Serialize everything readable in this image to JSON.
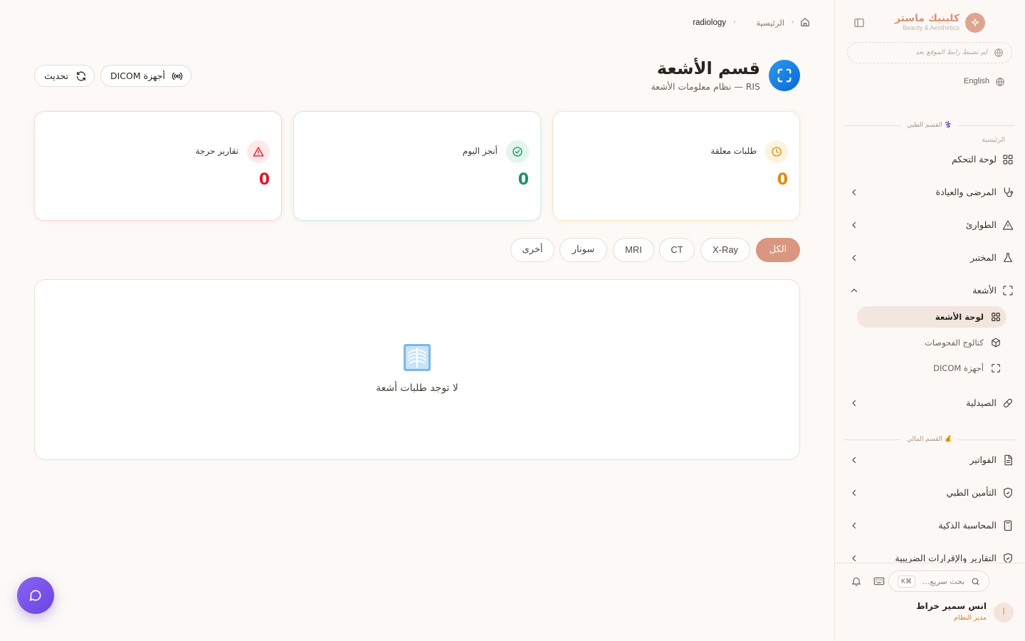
{
  "sidebar": {
    "brand": {
      "name": "كلينيك ماستر",
      "tagline": "Beauty & Aesthetics"
    },
    "site_url_placeholder": "لم تضبط رابط الموقع بعد",
    "language": "English",
    "medical_section": {
      "label": "⚕️ القسم الطبي",
      "caption": "الرئيسية"
    },
    "items": [
      {
        "label": "لوحة التحكم",
        "icon": "dashboard-icon"
      },
      {
        "label": "المرضى والعيادة",
        "icon": "stethoscope-icon"
      },
      {
        "label": "الطوارئ",
        "icon": "warning-icon"
      },
      {
        "label": "المختبر",
        "icon": "flask-icon"
      },
      {
        "label": "الأشعة",
        "icon": "scan-icon",
        "expanded": true
      },
      {
        "label": "الصيدلية",
        "icon": "pill-icon"
      }
    ],
    "radiology_sub": [
      {
        "label": "لوحة الأشعة",
        "icon": "dashboard-icon",
        "active": true
      },
      {
        "label": "كتالوج الفحوصات",
        "icon": "box-icon"
      },
      {
        "label": "أجهزة DICOM",
        "icon": "scan-icon"
      }
    ],
    "financial_section": {
      "label": "💰 القسم المالي"
    },
    "financial_items": [
      {
        "label": "الفواتير",
        "icon": "invoice-icon"
      },
      {
        "label": "التأمين الطبي",
        "icon": "shield-icon"
      },
      {
        "label": "المحاسبة الذكية",
        "icon": "calculator-icon"
      },
      {
        "label": "التقارير والإقرارات الضريبية",
        "icon": "shield-icon"
      }
    ],
    "footer": {
      "search_placeholder": "بحث سريع...",
      "shortcut": "⌘K",
      "user": {
        "initial": "ا",
        "name": "انس سمير خراط",
        "role": "مدير النظام"
      }
    }
  },
  "breadcrumb": {
    "home_icon": "home-icon",
    "parent": "الرئيسية",
    "current": "radiology"
  },
  "header": {
    "title": "قسم الأشعة",
    "subtitle": "RIS — نظام معلومات الأشعة",
    "dicom_button": "أجهزة DICOM",
    "refresh_button": "تحديث"
  },
  "stats": {
    "pending": {
      "label": "طلبات معلقة",
      "value": "0",
      "color": "#e0890f"
    },
    "done_today": {
      "label": "أنجز اليوم",
      "value": "0",
      "color": "#1a9461"
    },
    "critical": {
      "label": "تقارير حرجة",
      "value": "0",
      "color": "#d81b2a"
    }
  },
  "filters": {
    "all": "الكل",
    "xray": "X-Ray",
    "ct": "CT",
    "mri": "MRI",
    "sonar": "سونار",
    "other": "أخرى",
    "active": "all"
  },
  "empty_state": {
    "icon": "xray-chest-icon",
    "text": "لا توجد طلبات أشعة"
  },
  "colors": {
    "accent": "#d99680",
    "brand": "#d98f74",
    "fab": "#7a55ec",
    "page_icon": "#1a84e6"
  }
}
